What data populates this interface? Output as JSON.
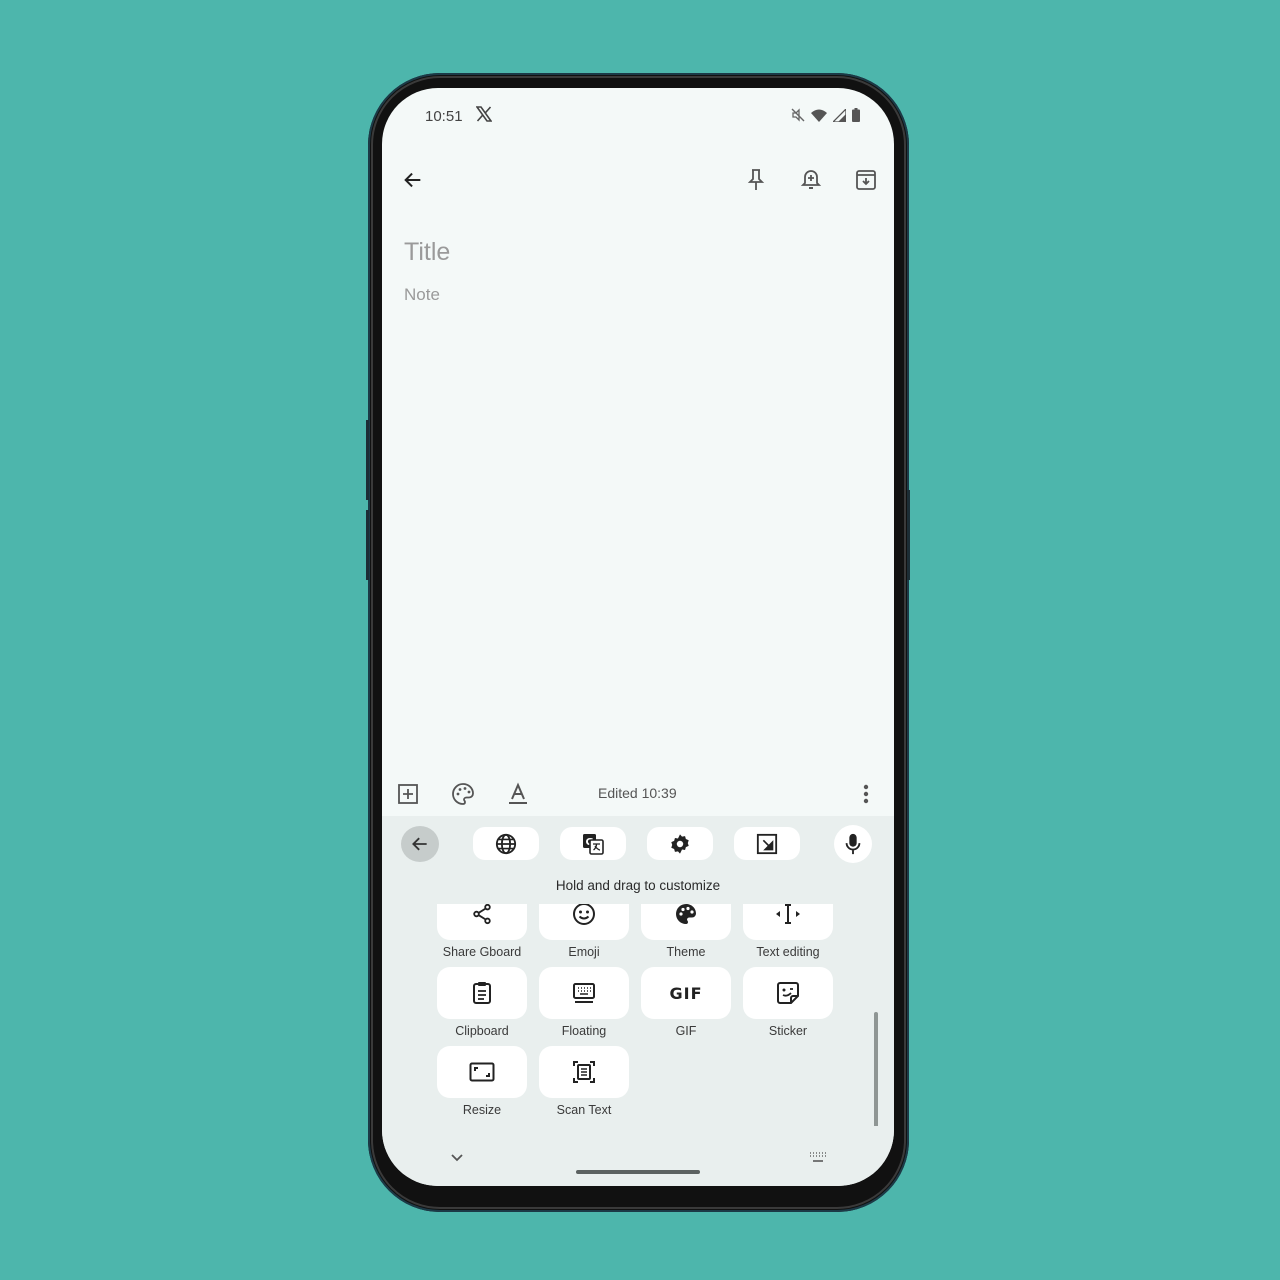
{
  "statusbar": {
    "time": "10:51",
    "app_icon": "x-icon",
    "icons": [
      "mute-icon",
      "wifi-icon",
      "cellular-icon",
      "battery-icon"
    ]
  },
  "appbar": {
    "back_icon": "back-arrow-icon",
    "actions": [
      "pin-icon",
      "reminder-icon",
      "archive-icon"
    ]
  },
  "note": {
    "title_placeholder": "Title",
    "body_placeholder": "Note"
  },
  "bottombar": {
    "edited": "Edited 10:39",
    "left_icons": [
      "add-box-icon",
      "palette-icon",
      "text-format-icon"
    ],
    "more_icon": "more-vert-icon"
  },
  "keyboard": {
    "toolbar": [
      "back-arrow-icon",
      "globe-icon",
      "translate-icon",
      "settings-icon",
      "one-handed-icon",
      "mic-icon"
    ],
    "hint": "Hold and drag to customize",
    "tiles": [
      {
        "label": "Share Gboard",
        "icon": "share-icon"
      },
      {
        "label": "Emoji",
        "icon": "emoji-icon"
      },
      {
        "label": "Theme",
        "icon": "palette-icon"
      },
      {
        "label": "Text editing",
        "icon": "text-cursor-icon"
      },
      {
        "label": "Clipboard",
        "icon": "clipboard-icon"
      },
      {
        "label": "Floating",
        "icon": "floating-keyboard-icon"
      },
      {
        "label": "GIF",
        "icon": "gif-icon"
      },
      {
        "label": "Sticker",
        "icon": "sticker-icon"
      },
      {
        "label": "Resize",
        "icon": "resize-icon"
      },
      {
        "label": "Scan Text",
        "icon": "scan-text-icon"
      }
    ],
    "gif_text": "GIF"
  },
  "colors": {
    "background": "#4db6ac",
    "screen": "#f4f9f8",
    "keyboard": "#e9efee",
    "tile": "#ffffff"
  }
}
